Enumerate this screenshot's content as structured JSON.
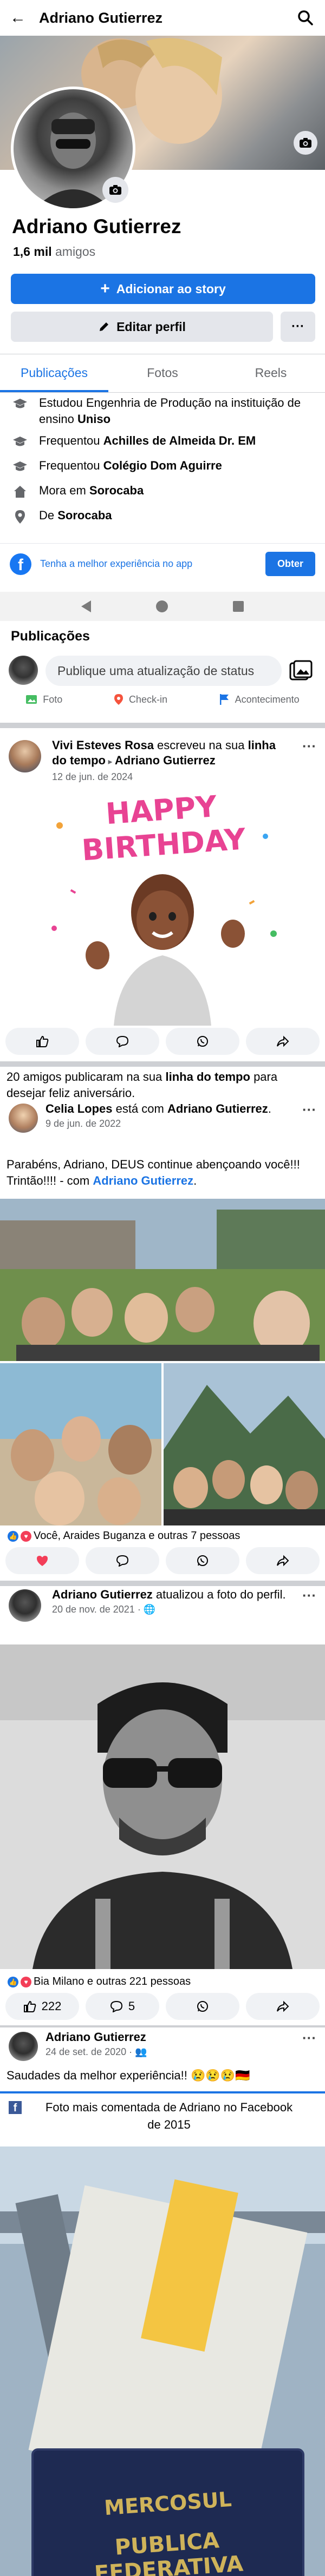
{
  "header": {
    "title": "Adriano Gutierrez"
  },
  "profile": {
    "name": "Adriano Gutierrez",
    "friends_count": "1,6 mil",
    "friends_label": "amigos",
    "add_story_label": "Adicionar ao story",
    "edit_profile_label": "Editar perfil",
    "more_label": "···"
  },
  "tabs": [
    {
      "label": "Publicações",
      "active": true
    },
    {
      "label": "Fotos",
      "active": false
    },
    {
      "label": "Reels",
      "active": false
    }
  ],
  "details": {
    "study_prefix": "Estudou Engenhria de Produção na instituição de ensino ",
    "study_place": "Uniso",
    "attended1_prefix": "Frequentou ",
    "attended1_place": "Achilles de Almeida Dr. EM",
    "attended2_prefix": "Frequentou ",
    "attended2_place": "Colégio Dom Aguirre",
    "lives_prefix": "Mora em ",
    "lives_place": "Sorocaba",
    "from_prefix": "De ",
    "from_place": "Sorocaba"
  },
  "banner": {
    "text": "Tenha a melhor experiência no app",
    "button": "Obter"
  },
  "posts_section": {
    "title": "Publicações",
    "composer_placeholder": "Publique uma atualização de status",
    "actions": [
      "Foto",
      "Check-in",
      "Acontecimento"
    ]
  },
  "post1": {
    "author": "Vivi Esteves Rosa",
    "verb": " escreveu na sua ",
    "target_bold": "linha do tempo",
    "to_name": "Adriano Gutierrez",
    "date": "12 de jun. de 2024",
    "image_text": "HAPPY BIRTHDAY",
    "summary_prefix": "20 amigos publicaram na sua ",
    "summary_bold": "linha do tempo",
    "summary_suffix": " para desejar feliz aniversário."
  },
  "post2": {
    "author": "Celia Lopes",
    "verb": " está com ",
    "with_name": "Adriano Gutierrez",
    "date": "9 de jun. de 2022",
    "text_prefix": "Parabéns, Adriano, DEUS continue abençoando você!!! Trintão!!!! - com ",
    "text_link": "Adriano Gutierrez",
    "text_suffix": ".",
    "reactions": "Você, Araides Buganza e outras 7 pessoas"
  },
  "post3": {
    "author": "Adriano Gutierrez",
    "verb": " atualizou a foto do perfil.",
    "date": "20 de nov. de 2021",
    "reactions": "Bia Milano e outras 221 pessoas",
    "like_count": "222",
    "comment_count": "5"
  },
  "post4": {
    "author": "Adriano Gutierrez",
    "date": "24 de set. de 2020",
    "text": "Saudades da melhor experiência!! 😢😢😢🇩🇪",
    "memory_title": "Foto mais comentada de Adriano no Facebook de 2015",
    "image_text_1": "MERCOSUL",
    "image_text_2": "PUBLICA FEDERATIVA"
  },
  "colors": {
    "accent": "#1b74e4",
    "divider": "#ced0d4",
    "muted": "#65676b"
  }
}
